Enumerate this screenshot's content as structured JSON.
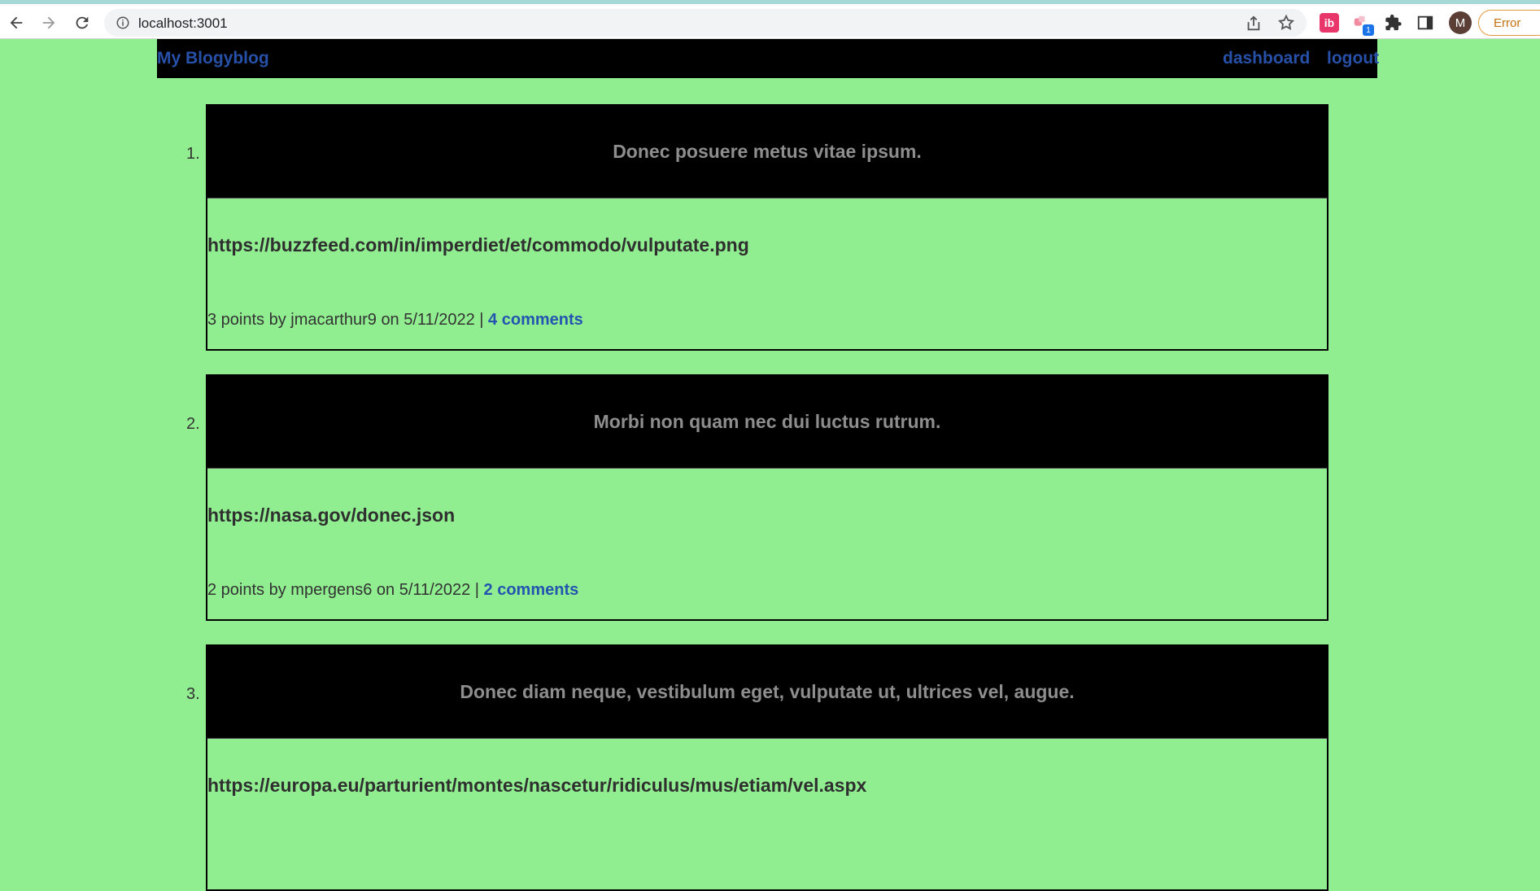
{
  "browser": {
    "url": "localhost:3001",
    "ext_ib": "ib",
    "ext_badge": "1",
    "avatar_letter": "M",
    "error_label": "Error"
  },
  "header": {
    "brand": "My Blogyblog",
    "dashboard": "dashboard",
    "logout": "logout"
  },
  "posts": [
    {
      "number": "1.",
      "title": "Donec posuere metus vitae ipsum.",
      "url": "https://buzzfeed.com/in/imperdiet/et/commodo/vulputate.png",
      "meta": "3 points by jmacarthur9 on 5/11/2022 | ",
      "comments": "4 comments"
    },
    {
      "number": "2.",
      "title": "Morbi non quam nec dui luctus rutrum.",
      "url": "https://nasa.gov/donec.json",
      "meta": "2 points by mpergens6 on 5/11/2022 | ",
      "comments": "2 comments"
    },
    {
      "number": "3.",
      "title": "Donec diam neque, vestibulum eget, vulputate ut, ultrices vel, augue.",
      "url": "https://europa.eu/parturient/montes/nascetur/ridiculus/mus/etiam/vel.aspx",
      "meta": "",
      "comments": ""
    }
  ]
}
